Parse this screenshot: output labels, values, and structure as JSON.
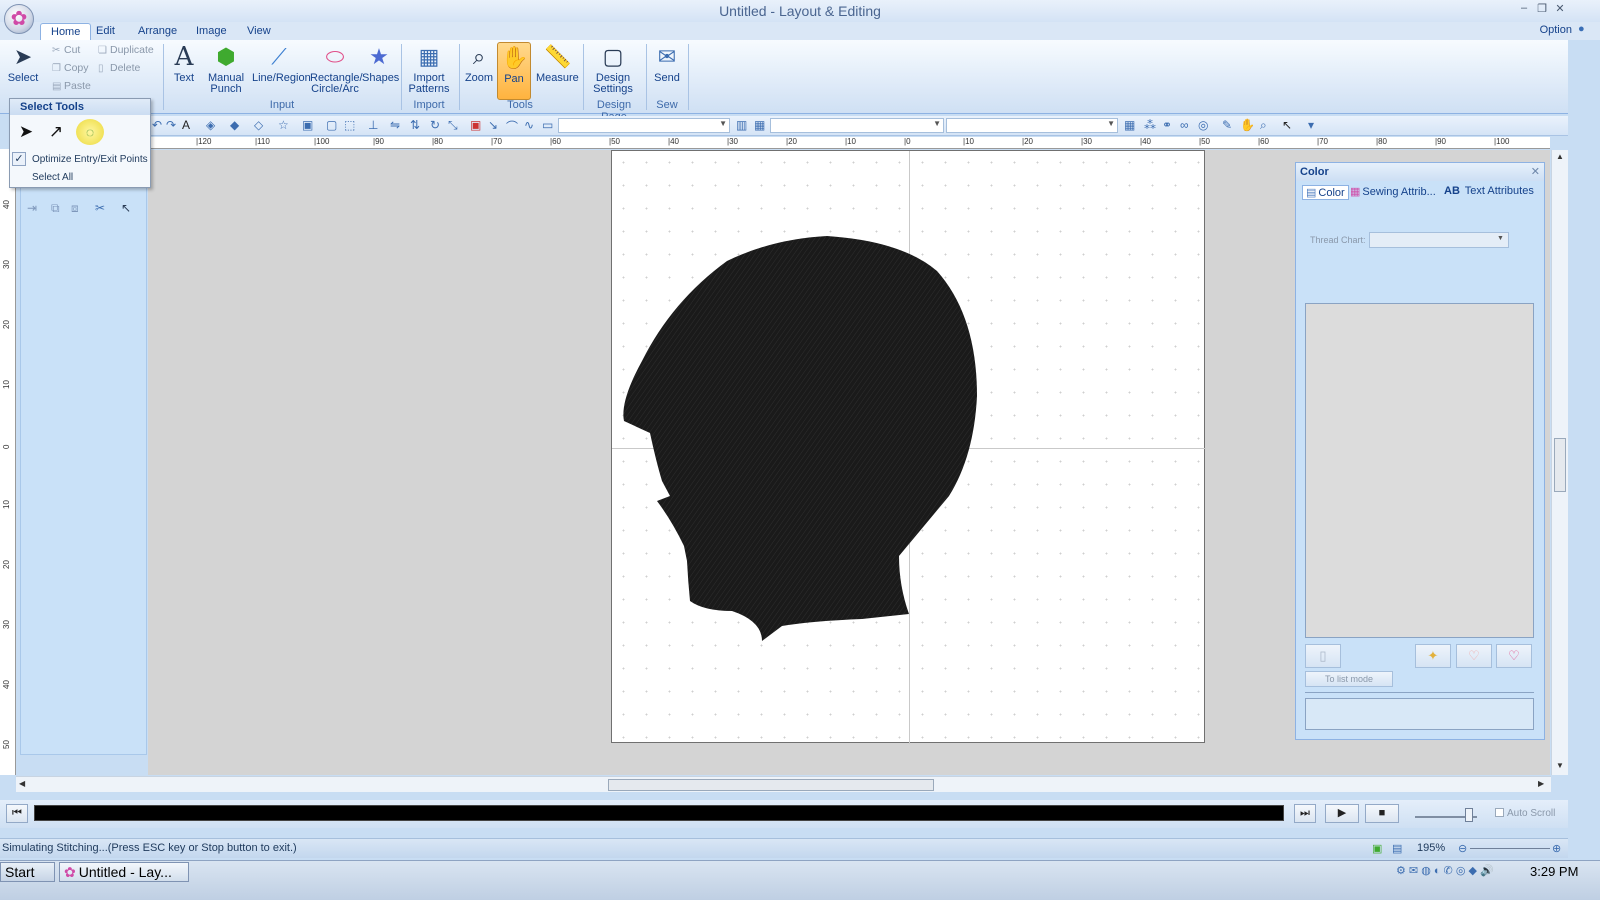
{
  "window": {
    "title": "Untitled - Layout & Editing",
    "minimize": "–",
    "restore": "❐",
    "close": "✕"
  },
  "tabs": [
    {
      "label": "Home"
    },
    {
      "label": "Edit"
    },
    {
      "label": "Arrange"
    },
    {
      "label": "Image"
    },
    {
      "label": "View"
    }
  ],
  "option_menu": "Option",
  "ribbon": {
    "select": "Select",
    "cut": "Cut",
    "copy": "Copy",
    "paste": "Paste",
    "duplicate": "Duplicate",
    "delete": "Delete",
    "text": "Text",
    "manual_punch_1": "Manual",
    "manual_punch_2": "Punch",
    "line_region": "Line/Region",
    "rect_1": "Rectangle/",
    "rect_2": "Circle/Arc",
    "shapes": "Shapes",
    "import_1": "Import",
    "import_2": "Patterns",
    "zoom": "Zoom",
    "pan": "Pan",
    "measure": "Measure",
    "design_1": "Design",
    "design_2": "Settings",
    "send": "Send",
    "groups": {
      "input": "Input",
      "import": "Import",
      "tools": "Tools",
      "design_page": "Design Page",
      "sew": "Sew"
    }
  },
  "ruler_h": [
    "120",
    "110",
    "100",
    "90",
    "80",
    "70",
    "60",
    "50",
    "40",
    "30",
    "20",
    "10",
    "0",
    "10",
    "20",
    "30",
    "40",
    "50",
    "60",
    "70",
    "80",
    "90",
    "100"
  ],
  "ruler_v": [
    "40",
    "30",
    "20",
    "10",
    "0",
    "10",
    "20",
    "30",
    "40",
    "50"
  ],
  "select_tools": {
    "title": "Select Tools",
    "optimize": "Optimize Entry/Exit Points",
    "optimize_checked": true,
    "select_all": "Select All"
  },
  "color_panel": {
    "title": "Color",
    "tabs": [
      "Color",
      "Sewing Attrib...",
      "Text Attributes"
    ],
    "text_attr_prefix": "AB",
    "thread_chart_label": "Thread Chart:",
    "thread_chart_value": "",
    "list_mode": "To list mode"
  },
  "simulator": {
    "auto_scroll": "Auto Scroll",
    "auto_scroll_checked": false
  },
  "status": {
    "message": "Simulating Stitching...(Press ESC key or Stop button to exit.)",
    "zoom": "195%"
  },
  "taskbar": {
    "start": "Start",
    "task": "Untitled - Lay...",
    "clock": "3:29 PM"
  },
  "colors": {
    "ribbon_blue": "#dbe8f7",
    "workspace_gray": "#d4d4d4",
    "pressed_orange": "#ffb33f",
    "silhouette": "#1a1a1a"
  }
}
